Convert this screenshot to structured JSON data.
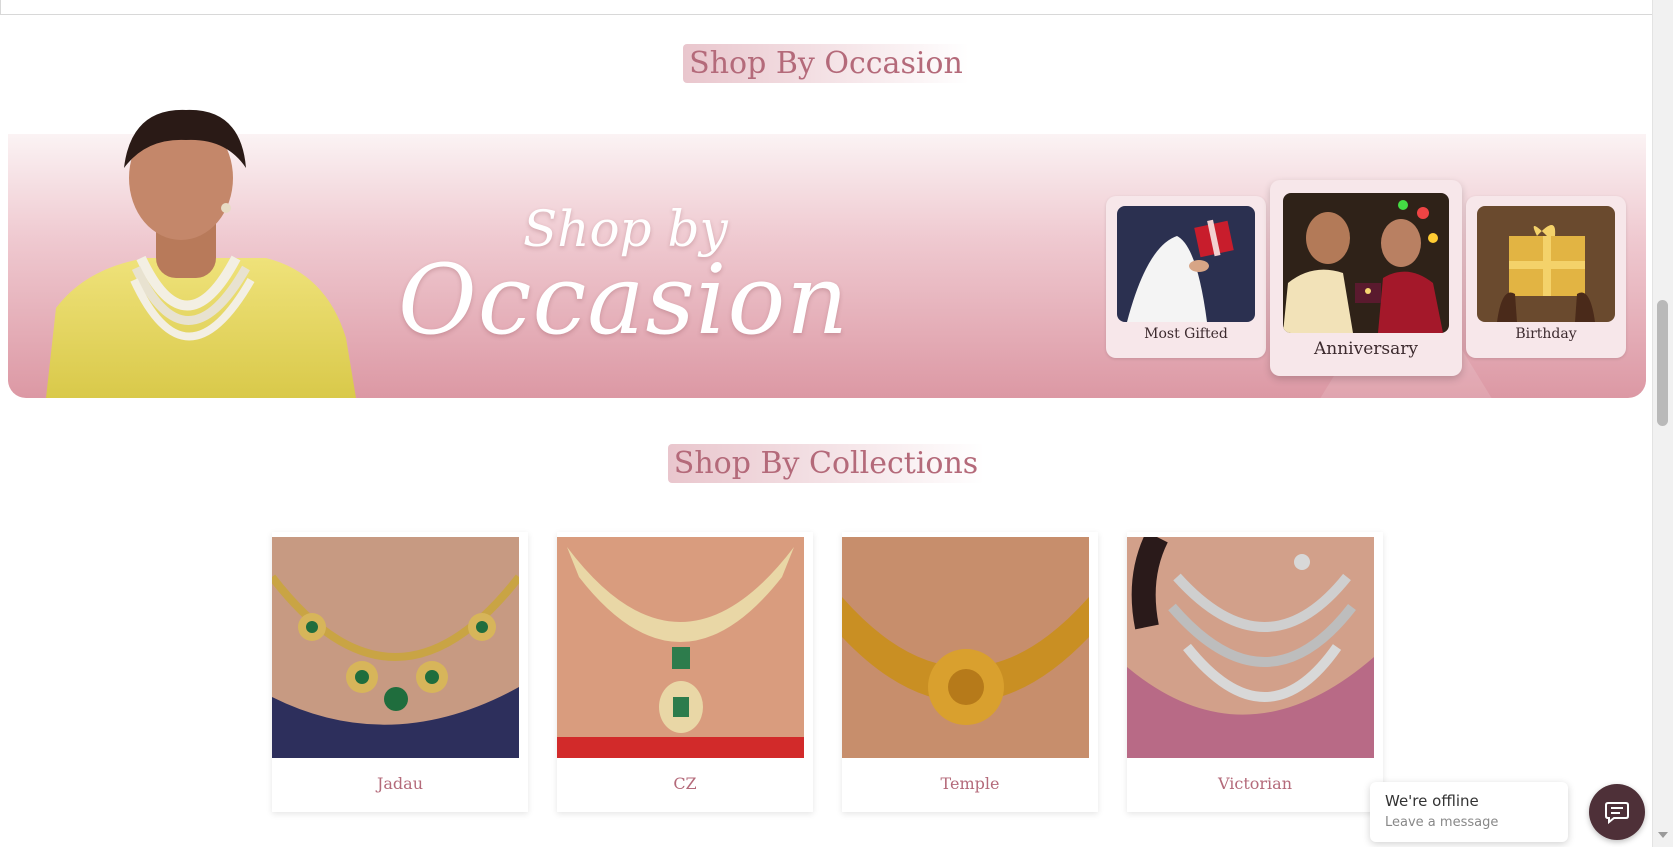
{
  "sections": {
    "occasion_heading": "Shop By Occasion",
    "collections_heading": "Shop By Collections"
  },
  "banner": {
    "title_line1": "Shop by",
    "title_line2": "Occasion"
  },
  "occasions": [
    {
      "label": "Most Gifted",
      "image": "gift-box-photo"
    },
    {
      "label": "Anniversary",
      "image": "couple-ring-photo"
    },
    {
      "label": "Birthday",
      "image": "gold-gift-photo"
    }
  ],
  "collections": [
    {
      "label": "Jadau",
      "image": "jadau-necklace-photo"
    },
    {
      "label": "CZ",
      "image": "cz-necklace-photo"
    },
    {
      "label": "Temple",
      "image": "temple-necklace-photo"
    },
    {
      "label": "Victorian",
      "image": "victorian-necklace-photo"
    }
  ],
  "chat": {
    "status": "We're offline",
    "prompt": "Leave a message"
  },
  "colors": {
    "accent": "#b46a7a",
    "banner_pink": "#dc98a4",
    "chat_button": "#4e3038"
  }
}
